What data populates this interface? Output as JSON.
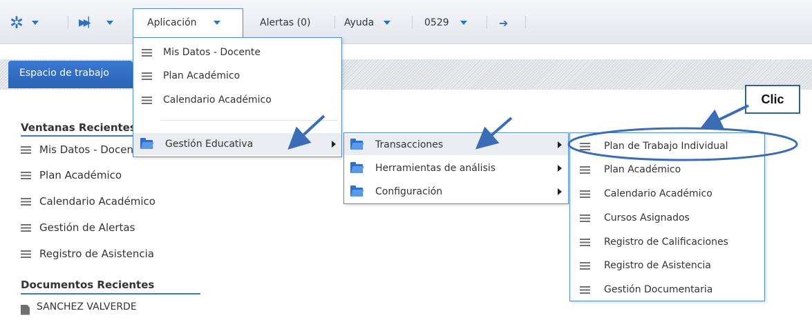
{
  "toolbar": {
    "app_menu": "Aplicación",
    "alerts": "Alertas (0)",
    "help": "Ayuda",
    "user_code": "0529"
  },
  "workspace_tab": "Espacio de trabajo",
  "recent_windows": {
    "title": "Ventanas Recientes",
    "items": [
      "Mis Datos - Docente",
      "Plan Académico",
      "Calendario Académico",
      "Gestión de Alertas",
      "Registro de Asistencia"
    ]
  },
  "recent_documents": {
    "title": "Documentos Recientes",
    "items": [
      "SANCHEZ VALVERDE"
    ]
  },
  "app_menu": {
    "items": [
      "Mis Datos - Docente",
      "Plan Académico",
      "Calendario Académico",
      "Gestión Educativa"
    ]
  },
  "gestion_menu": {
    "items": [
      "Transacciones",
      "Herramientas de análisis",
      "Configuración"
    ]
  },
  "transacciones_menu": {
    "items": [
      "Plan de Trabajo Individual",
      "Plan Académico",
      "Calendario Académico",
      "Cursos Asignados",
      "Registro de Calificaciones",
      "Registro de Asistencia",
      "Gestión Documentaria"
    ]
  },
  "callout_label": "Clic",
  "colors": {
    "accent": "#2c6fd0",
    "annotation": "#3a6db5",
    "menu_border": "#4f8ad6"
  }
}
